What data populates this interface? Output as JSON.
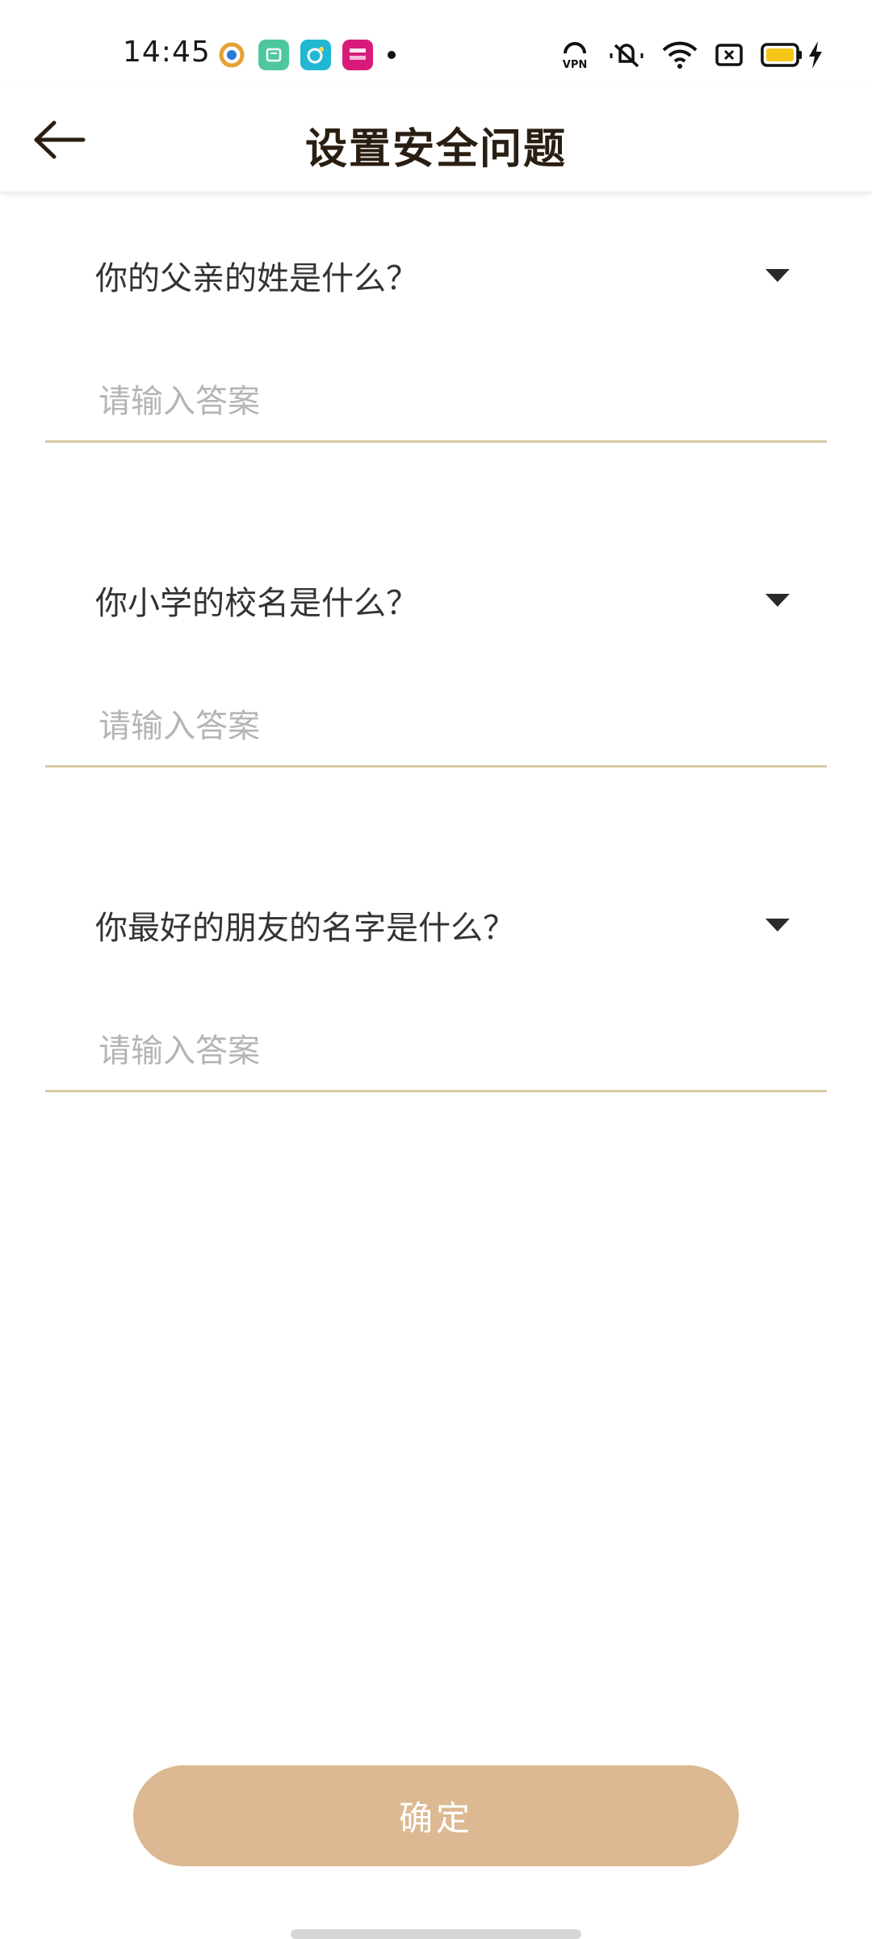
{
  "status_bar": {
    "time": "14:45",
    "notification_icons": [
      {
        "name": "camera-app-icon",
        "color": "#e5a133"
      },
      {
        "name": "store-app-icon",
        "color": "#4ec7a0"
      },
      {
        "name": "chat-app-icon",
        "color": "#22b8d4"
      },
      {
        "name": "promo-app-icon",
        "color": "#d81b7a"
      }
    ],
    "system_icons": [
      "vpn-icon",
      "mute-icon",
      "wifi-icon",
      "sim-icon",
      "battery-icon",
      "charging-icon"
    ],
    "vpn_label": "VPN",
    "battery_color": "#f5c518"
  },
  "header": {
    "title": "设置安全问题"
  },
  "questions": [
    {
      "question": "你的父亲的姓是什么？",
      "answer_placeholder": "请输入答案",
      "answer_value": ""
    },
    {
      "question": "你小学的校名是什么？",
      "answer_placeholder": "请输入答案",
      "answer_value": ""
    },
    {
      "question": "你最好的朋友的名字是什么？",
      "answer_placeholder": "请输入答案",
      "answer_value": ""
    }
  ],
  "confirm": {
    "label": "确定"
  },
  "colors": {
    "accent": "#dcb992",
    "underline": "#d9c9a6",
    "title": "#2a1e12"
  }
}
